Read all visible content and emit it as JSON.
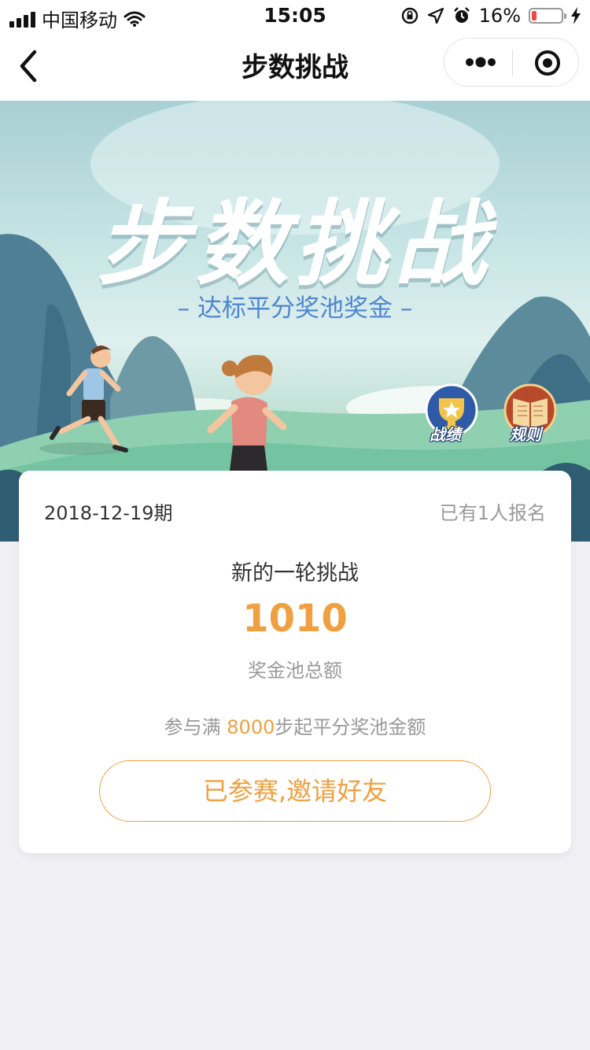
{
  "status_bar": {
    "carrier": "中国移动",
    "time": "15:05",
    "battery_percent": "16%",
    "battery_level": 0.16
  },
  "nav": {
    "title": "步数挑战",
    "icons": [
      "back-arrow-icon",
      "more-icon",
      "target-icon"
    ]
  },
  "banner": {
    "title": "步数挑战",
    "subtitle": "– 达标平分奖池奖金 –",
    "record_label": "战绩",
    "rules_label": "规则",
    "colors": {
      "sky": "#c9e6e6",
      "grass": "#8fcfb4",
      "subtitle": "#4f86d0"
    }
  },
  "card": {
    "period": "2018-12-19期",
    "enrolled": "已有1人报名",
    "round_title": "新的一轮挑战",
    "pool_amount": "1010",
    "pool_label": "奖金池总额",
    "rule_prefix": "参与满 ",
    "rule_steps": "8000",
    "rule_suffix": "步起平分奖池金额",
    "button_label": "已参赛,邀请好友",
    "accent_color": "#f0a040"
  }
}
